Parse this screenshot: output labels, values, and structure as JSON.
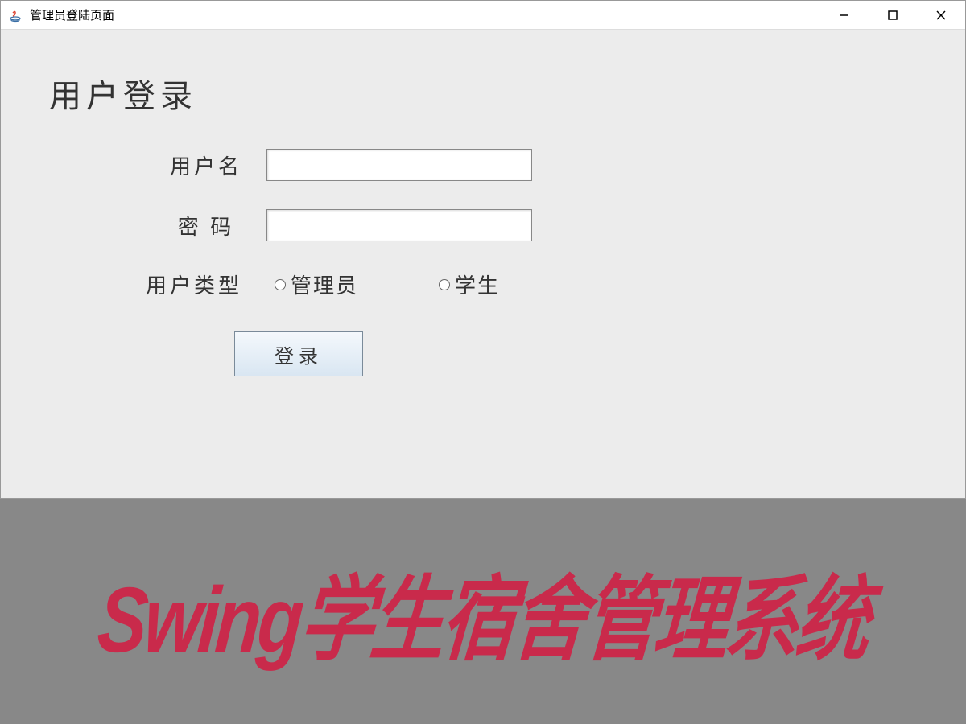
{
  "window": {
    "title": "管理员登陆页面"
  },
  "page": {
    "heading": "用户登录"
  },
  "form": {
    "username_label": "用户名",
    "username_value": "",
    "password_label": "密 码",
    "password_value": "",
    "user_type_label": "用户类型",
    "radio_admin_label": "管理员",
    "radio_student_label": "学生",
    "login_button_label": "登录"
  },
  "banner": {
    "text": "Swing学生宿舍管理系统"
  }
}
